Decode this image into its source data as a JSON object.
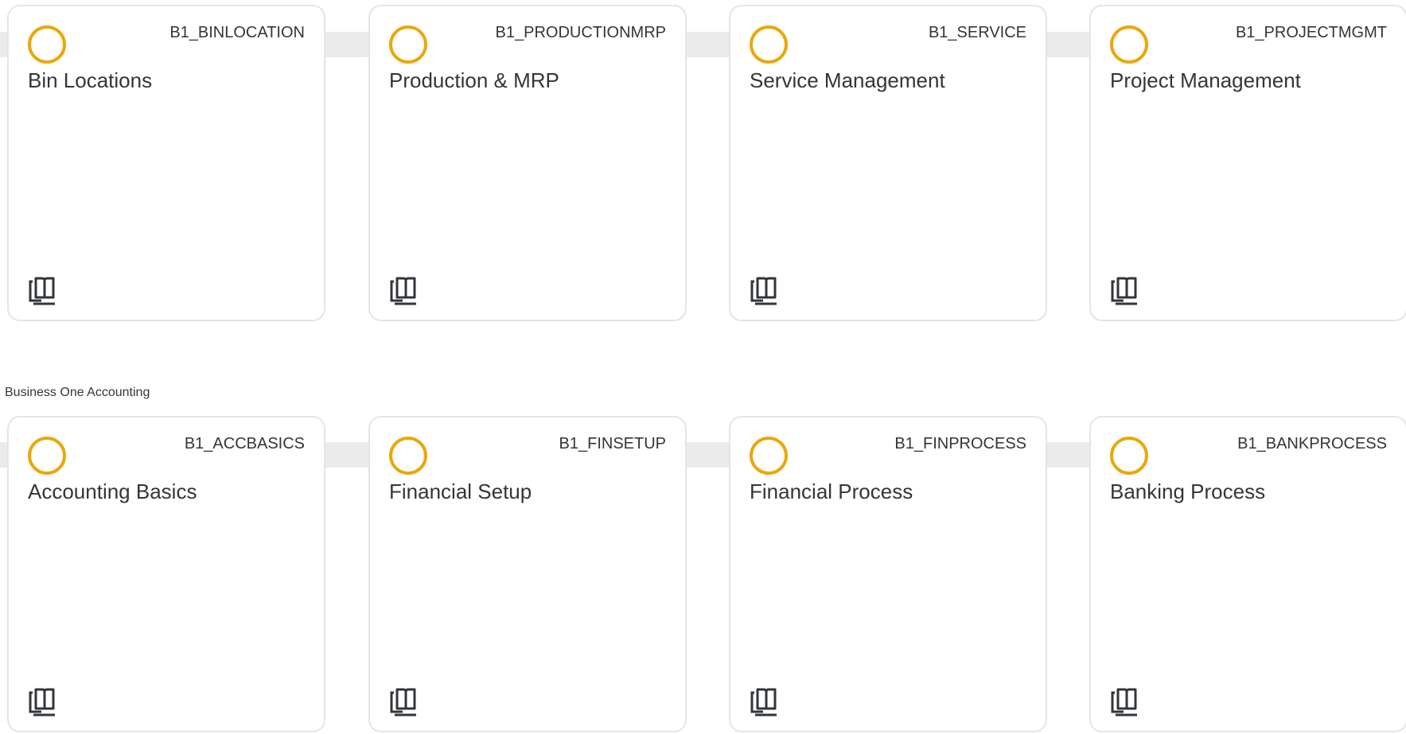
{
  "sections": [
    {
      "title": "",
      "cards": [
        {
          "code": "B1_BINLOCATION",
          "name": "Bin Locations",
          "status_icon": "status-ring-icon",
          "action_icon": "book-icon"
        },
        {
          "code": "B1_PRODUCTIONMRP",
          "name": "Production & MRP",
          "status_icon": "status-ring-icon",
          "action_icon": "book-icon"
        },
        {
          "code": "B1_SERVICE",
          "name": "Service Management",
          "status_icon": "status-ring-icon",
          "action_icon": "book-icon"
        },
        {
          "code": "B1_PROJECTMGMT",
          "name": "Project Management",
          "status_icon": "status-ring-icon",
          "action_icon": "book-icon"
        }
      ]
    },
    {
      "title": "Business One Accounting",
      "cards": [
        {
          "code": "B1_ACCBASICS",
          "name": "Accounting Basics",
          "status_icon": "status-ring-icon",
          "action_icon": "book-icon"
        },
        {
          "code": "B1_FINSETUP",
          "name": "Financial Setup",
          "status_icon": "status-ring-icon",
          "action_icon": "book-icon"
        },
        {
          "code": "B1_FINPROCESS",
          "name": "Financial Process",
          "status_icon": "status-ring-icon",
          "action_icon": "book-icon"
        },
        {
          "code": "B1_BANKPROCESS",
          "name": "Banking Process",
          "status_icon": "status-ring-icon",
          "action_icon": "book-icon"
        }
      ]
    }
  ],
  "colors": {
    "status_ring": "#e9a80b",
    "track": "#ebebeb",
    "card_border": "#e5e5e5",
    "text": "#32363a"
  }
}
